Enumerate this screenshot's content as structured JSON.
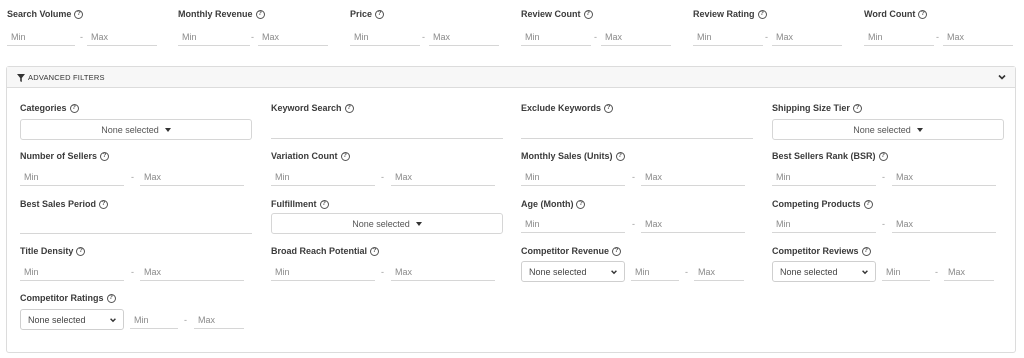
{
  "top_filters": [
    {
      "label": "Search Volume",
      "min": "Min",
      "max": "Max"
    },
    {
      "label": "Monthly Revenue",
      "min": "Min",
      "max": "Max"
    },
    {
      "label": "Price",
      "min": "Min",
      "max": "Max"
    },
    {
      "label": "Review Count",
      "min": "Min",
      "max": "Max"
    },
    {
      "label": "Review Rating",
      "min": "Min",
      "max": "Max"
    },
    {
      "label": "Word Count",
      "min": "Min",
      "max": "Max"
    }
  ],
  "help_glyph": "?",
  "dash": "-",
  "advanced": {
    "title": "ADVANCED FILTERS",
    "categories": {
      "label": "Categories",
      "value": "None selected"
    },
    "keyword_search": {
      "label": "Keyword Search",
      "value": ""
    },
    "exclude_keywords": {
      "label": "Exclude Keywords",
      "value": ""
    },
    "shipping_size_tier": {
      "label": "Shipping Size Tier",
      "value": "None selected"
    },
    "number_of_sellers": {
      "label": "Number of Sellers",
      "min": "Min",
      "max": "Max"
    },
    "variation_count": {
      "label": "Variation Count",
      "min": "Min",
      "max": "Max"
    },
    "monthly_sales": {
      "label": "Monthly Sales (Units)",
      "min": "Min",
      "max": "Max"
    },
    "bsr": {
      "label": "Best Sellers Rank (BSR)",
      "min": "Min",
      "max": "Max"
    },
    "best_sales_period": {
      "label": "Best Sales Period",
      "value": ""
    },
    "fulfillment": {
      "label": "Fulfillment",
      "value": "None selected"
    },
    "age_month": {
      "label": "Age (Month)",
      "min": "Min",
      "max": "Max"
    },
    "competing_products": {
      "label": "Competing Products",
      "min": "Min",
      "max": "Max"
    },
    "title_density": {
      "label": "Title Density",
      "min": "Min",
      "max": "Max"
    },
    "broad_reach_potential": {
      "label": "Broad Reach Potential",
      "min": "Min",
      "max": "Max"
    },
    "competitor_revenue": {
      "label": "Competitor Revenue",
      "select": "None selected",
      "min": "Min",
      "max": "Max"
    },
    "competitor_reviews": {
      "label": "Competitor Reviews",
      "select": "None selected",
      "min": "Min",
      "max": "Max"
    },
    "competitor_ratings": {
      "label": "Competitor Ratings",
      "select": "None selected",
      "min": "Min",
      "max": "Max"
    }
  }
}
